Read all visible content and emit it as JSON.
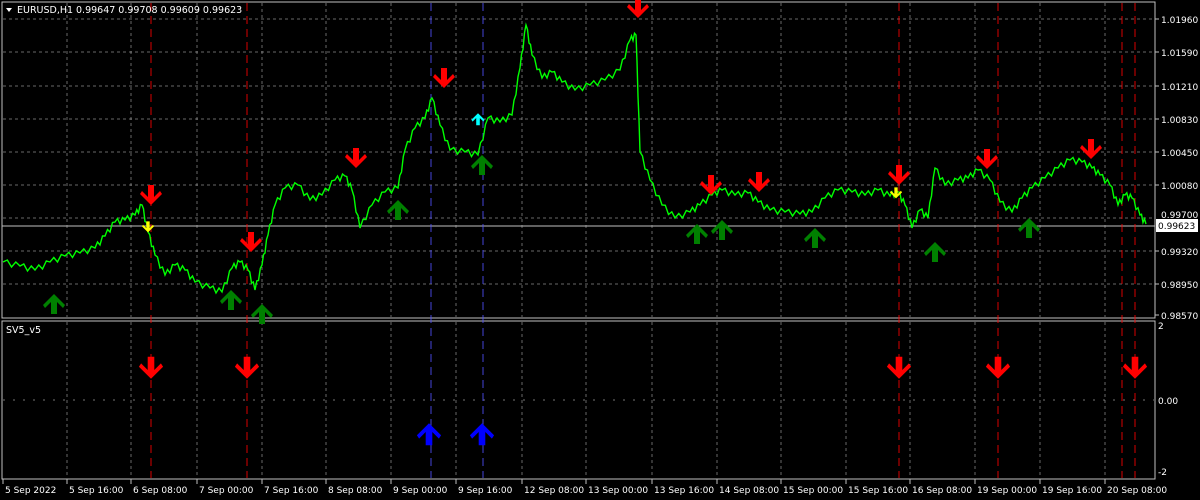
{
  "header": {
    "symbol_tf": "EURUSD,H1",
    "ohlc": "0.99647 0.99708 0.99609 0.99623"
  },
  "indicator": {
    "name": "SV5_v5"
  },
  "price_axis": {
    "labels": [
      "1.01960",
      "1.01590",
      "1.01210",
      "1.00830",
      "1.00450",
      "1.00080",
      "0.99700",
      "0.99320",
      "0.98950",
      "0.98570"
    ],
    "current_price": "0.99623"
  },
  "indicator_axis": {
    "labels": [
      "2",
      "0.00",
      "-2"
    ]
  },
  "time_axis": {
    "labels": [
      "5 Sep 2022",
      "5 Sep 16:00",
      "6 Sep 08:00",
      "7 Sep 00:00",
      "7 Sep 16:00",
      "8 Sep 08:00",
      "9 Sep 00:00",
      "9 Sep 16:00",
      "12 Sep 08:00",
      "13 Sep 00:00",
      "13 Sep 16:00",
      "14 Sep 08:00",
      "15 Sep 00:00",
      "15 Sep 16:00",
      "16 Sep 08:00",
      "19 Sep 00:00",
      "19 Sep 16:00",
      "20 Sep 08:00"
    ]
  },
  "colors": {
    "background": "#000000",
    "grid": "#c0c0c0",
    "candles": "#00ff00",
    "sell_arrow": "#ff0000",
    "buy_arrow": "#008000",
    "yellow_arrow": "#ffff00",
    "cyan_arrow": "#00ffff",
    "blue_arrow": "#0000ff",
    "red_vline": "#ff0000",
    "blue_vline": "#5050ff"
  },
  "chart_data": {
    "type": "line",
    "symbol": "EURUSD",
    "timeframe": "H1",
    "ylim": [
      0.9857,
      1.0215
    ],
    "series": [
      {
        "name": "EURUSD",
        "x": [
          "5 Sep 2022",
          "5 Sep 16:00",
          "6 Sep 08:00",
          "7 Sep 00:00",
          "7 Sep 16:00",
          "8 Sep 08:00",
          "9 Sep 00:00",
          "9 Sep 16:00",
          "12 Sep 08:00",
          "13 Sep 00:00",
          "13 Sep 16:00",
          "14 Sep 08:00",
          "15 Sep 00:00",
          "15 Sep 16:00",
          "16 Sep 08:00",
          "19 Sep 00:00",
          "19 Sep 16:00",
          "20 Sep 08:00"
        ],
        "values": [
          0.9928,
          0.9935,
          0.9985,
          0.9895,
          1.001,
          1.002,
          1.01,
          1.0045,
          1.0185,
          1.015,
          0.998,
          1.0,
          0.999,
          1.001,
          0.9975,
          1.002,
          1.003,
          0.998
        ]
      }
    ],
    "signals": [
      {
        "type": "sell",
        "time": "6 Sep 08:00"
      },
      {
        "type": "sell",
        "time": "7 Sep 00:00"
      },
      {
        "type": "buy",
        "time": "9 Sep 00:00"
      },
      {
        "type": "buy",
        "time": "9 Sep 16:00"
      },
      {
        "type": "sell",
        "time": "16 Sep 08:00"
      },
      {
        "type": "sell",
        "time": "19 Sep 00:00"
      },
      {
        "type": "sell",
        "time": "20 Sep 08:00"
      }
    ]
  }
}
